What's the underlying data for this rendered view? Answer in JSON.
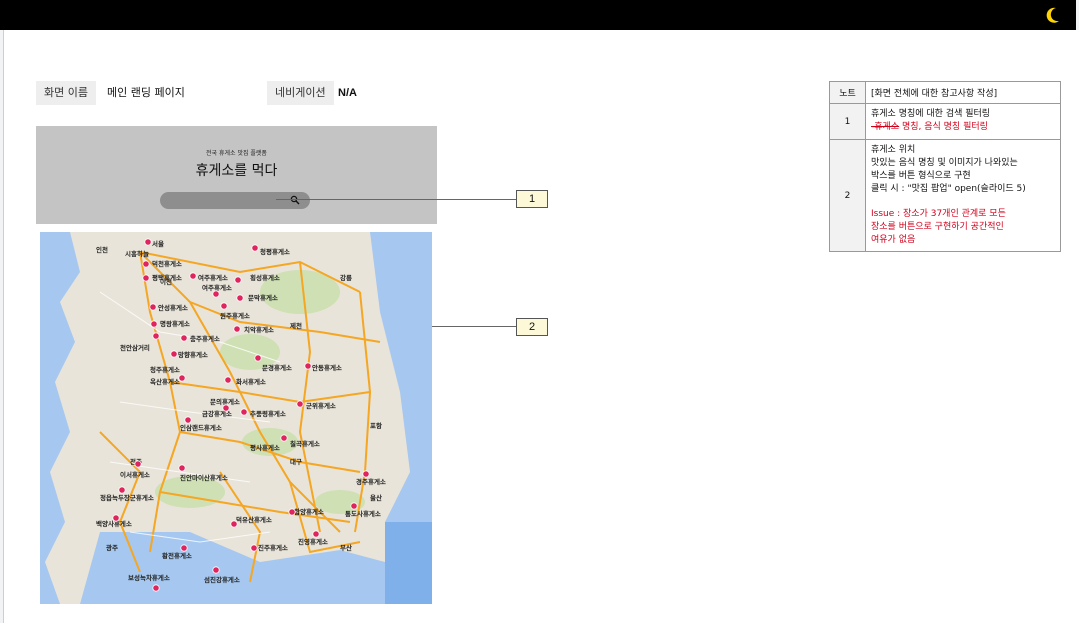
{
  "screen": {
    "name_label": "화면 이름",
    "name_value": "메인 랜딩 페이지",
    "nav_label": "네비게이션",
    "nav_value": "N/A"
  },
  "hero": {
    "subtitle": "전국 휴게소 맛집 플랫폼",
    "title": "휴게소를 먹다"
  },
  "callouts": [
    "1",
    "2"
  ],
  "notes": {
    "header_no": "노트",
    "header_desc": "[화면 전체에 대한 참고사항 작성]",
    "rows": [
      {
        "no": "1",
        "line1": "휴게소 명칭에 대한 검색 필터링",
        "line2_strike": "-휴게소",
        "line2_rest": " 명칭, 음식 명칭 필터링"
      },
      {
        "no": "2",
        "line1": "휴게소 위치",
        "line2": "맛있는 음식 명칭 및 이미지가 나와있는",
        "line3": "박스를 버튼 형식으로 구현",
        "line4": "클릭 시 : \"맛집 팝업\" open(슬라이드 5)",
        "issue1": "Issue : 장소가 37개인 관계로 모든",
        "issue2": "장소를 버튼으로 구현하기 공간적인",
        "issue3": "여유가 없음"
      }
    ]
  },
  "map": {
    "labels": [
      "서울",
      "청평휴게소",
      "인천",
      "시흥하늘",
      "덕천휴게소",
      "여주휴게소",
      "횡성휴게소",
      "여주휴게소",
      "이천",
      "평택휴게소",
      "강릉",
      "안성휴게소",
      "원주휴게소",
      "문막휴게소",
      "치악휴게소",
      "명왕휴게소",
      "천안삼거리",
      "충주휴게소",
      "제천",
      "망향휴게소",
      "문경휴게소",
      "칠곡휴게소",
      "군위휴게소",
      "안동휴게소",
      "청주휴게소",
      "옥산휴게소",
      "문의휴게소",
      "화서휴게소",
      "금강휴게소",
      "추풍령휴게소",
      "인삼랜드휴게소",
      "평사휴게소",
      "경주휴게소",
      "이서휴게소",
      "진안마이산휴게소",
      "정읍녹두장군휴게소",
      "통도사휴게소",
      "백양사휴게소",
      "덕유산휴게소",
      "함양휴게소",
      "진영휴게소",
      "황전휴게소",
      "진주휴게소",
      "보성녹차휴게소",
      "섬진강휴게소",
      "대구",
      "포항",
      "울산",
      "부산",
      "전주",
      "광주"
    ],
    "pin_color": "#e0245e",
    "road_color": "#f5a623",
    "sea_color": "#a6c8f0"
  },
  "colors": {
    "topbar": "#000000",
    "moon": "#ffd400",
    "hero_bg": "#c4c4c4",
    "callout_fill": "#fdf9d8",
    "issue_text": "#d0021b"
  }
}
